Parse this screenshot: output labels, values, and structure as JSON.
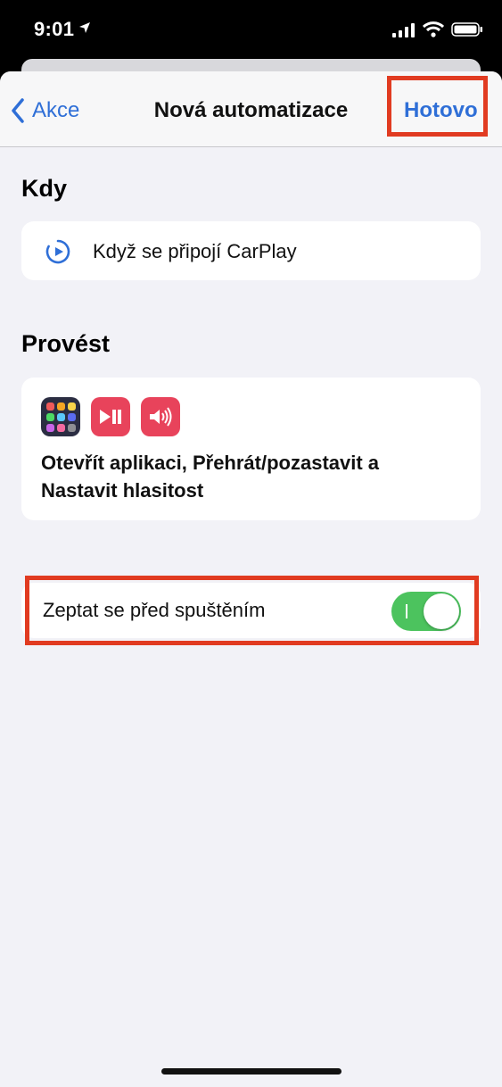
{
  "status_bar": {
    "time": "9:01",
    "icons": [
      "location-arrow-icon",
      "cellular-signal-icon",
      "wifi-icon",
      "battery-icon"
    ]
  },
  "nav": {
    "back_label": "Akce",
    "title": "Nová automatizace",
    "done_label": "Hotovo"
  },
  "sections": {
    "when_title": "Kdy",
    "do_title": "Provést"
  },
  "trigger": {
    "icon": "carplay-play-icon",
    "label": "Když se připojí CarPlay"
  },
  "actions": {
    "icons": [
      "open-app-icon",
      "play-pause-icon",
      "volume-icon"
    ],
    "summary": "Otevřít aplikaci, Přehrát/pozastavit a Nastavit hlasitost"
  },
  "ask_before_running": {
    "label": "Zeptat se před spuštěním",
    "enabled": true
  },
  "colors": {
    "accent": "#2f6fd7",
    "toggle_on": "#4cc35e",
    "highlight": "#e13b21",
    "play_pause_bg": "#e8435b",
    "open_app_bg": "#2b2d42"
  }
}
